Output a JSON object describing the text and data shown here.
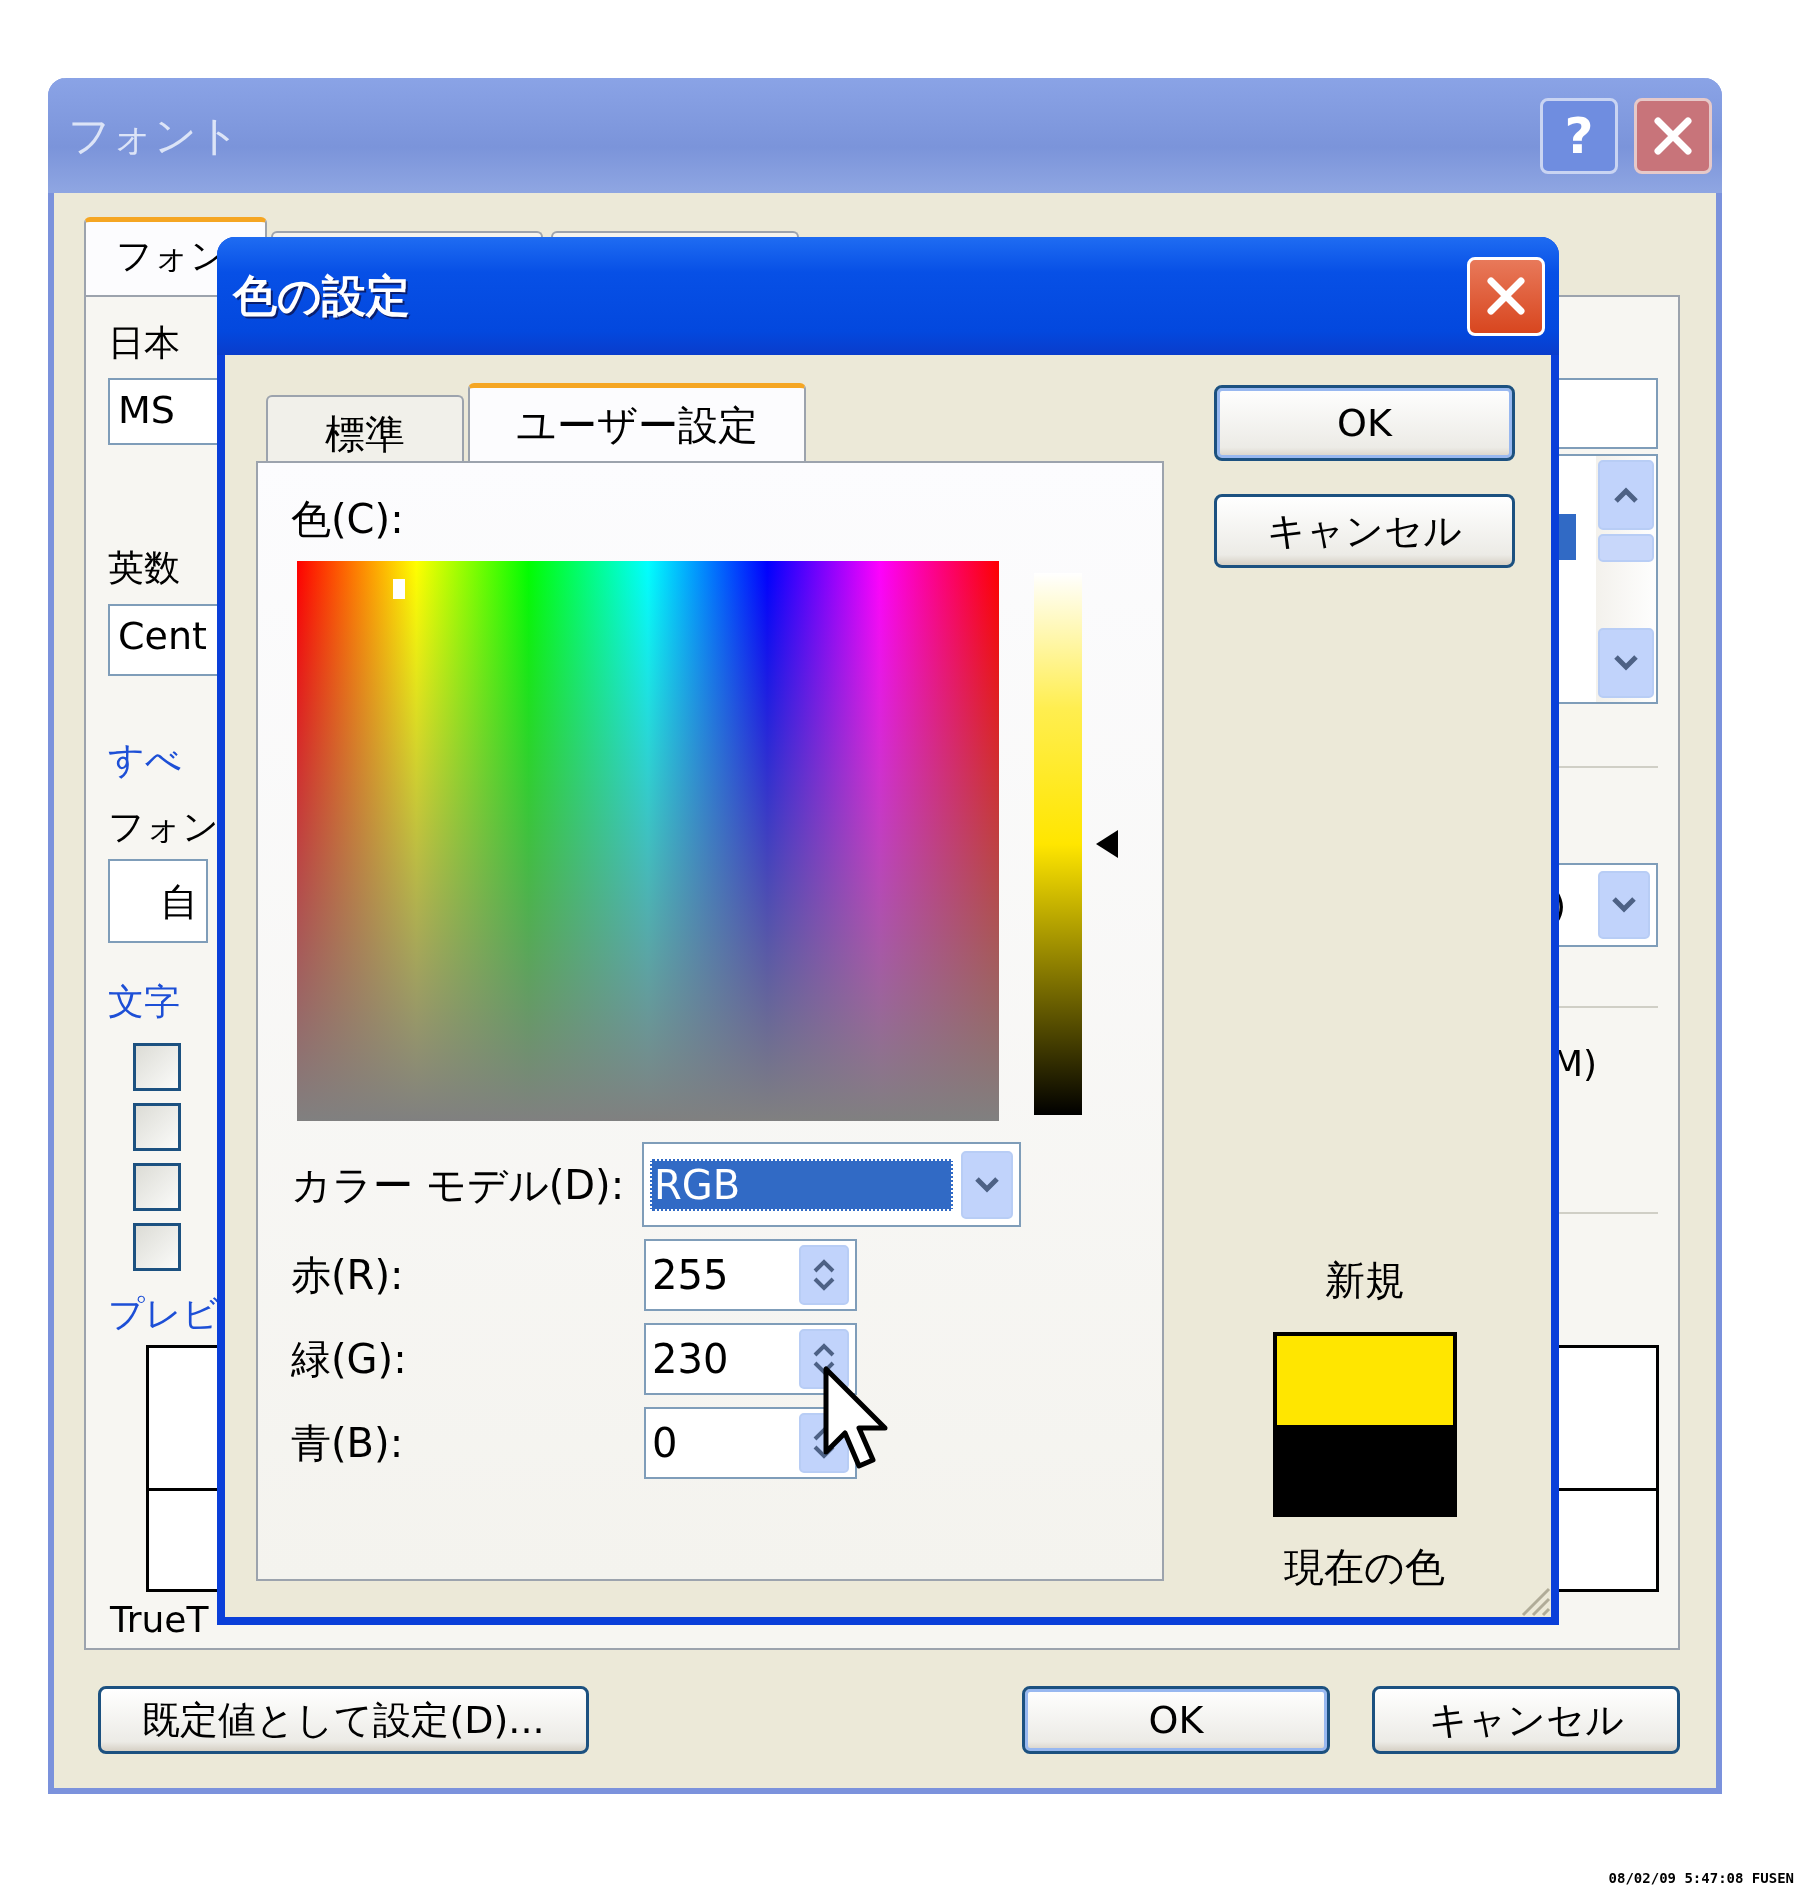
{
  "font_dialog": {
    "title": "フォント",
    "help_button": "?",
    "tabs": [
      {
        "label": "フォン",
        "selected": true
      },
      {
        "selected": false
      },
      {
        "selected": false
      }
    ],
    "japanese_font": {
      "label": "日本",
      "value": "MS"
    },
    "alphanumeric_font": {
      "label": "英数",
      "value": "Cent"
    },
    "link": "すべ",
    "font_color": {
      "label": "フォン",
      "value": "自",
      "right_value": ")"
    },
    "section": "文字",
    "checkboxes": [
      {
        "checked": false
      },
      {
        "checked": false
      },
      {
        "checked": false
      },
      {
        "checked": false
      }
    ],
    "effect_fragment": "M)",
    "preview": {
      "label": "プレビ",
      "note": "TrueT"
    },
    "buttons": {
      "default": "既定値として設定(D)...",
      "ok": "OK",
      "cancel": "キャンセル"
    }
  },
  "color_dialog": {
    "title": "色の設定",
    "tabs": [
      {
        "label": "標準",
        "selected": false
      },
      {
        "label": "ユーザー設定",
        "selected": true
      }
    ],
    "color_label": "色(C):",
    "color_model": {
      "label": "カラー モデル(D):",
      "value": "RGB"
    },
    "channels": [
      {
        "label": "赤(R):",
        "value": "255"
      },
      {
        "label": "緑(G):",
        "value": "230"
      },
      {
        "label": "青(B):",
        "value": "0"
      }
    ],
    "buttons": {
      "ok": "OK",
      "cancel": "キャンセル"
    },
    "swatches": [
      {
        "label": "新規",
        "color": "#ffe600"
      },
      {
        "label": "現在の色",
        "color": "#000000"
      }
    ]
  },
  "timestamp": "08/02/09 5:47:08 FUSEN"
}
